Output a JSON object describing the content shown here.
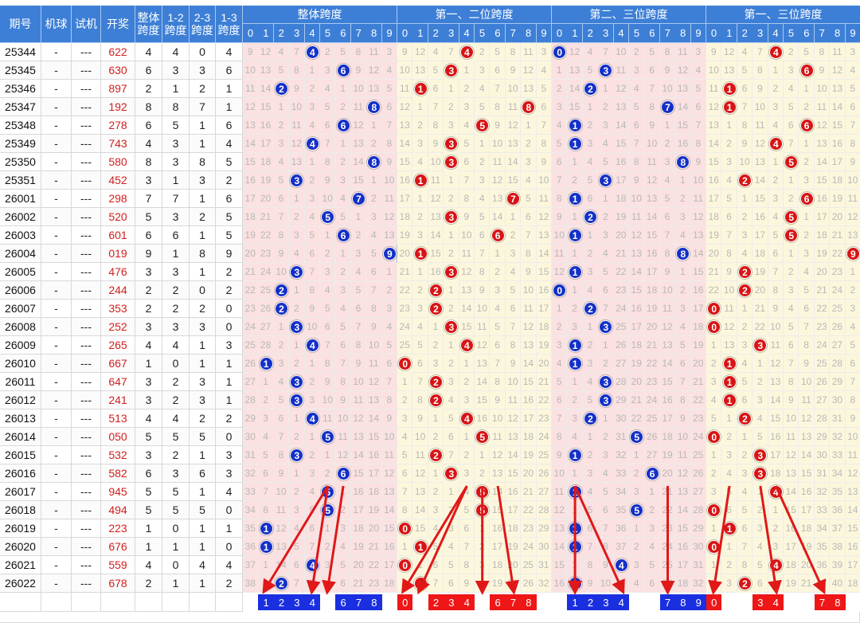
{
  "headers": {
    "issue": "期号",
    "machine_ball": "机球",
    "test_draw": "试机",
    "draw": "开奖",
    "span_total": "整体\n跨度",
    "span_12": "1-2\n跨度",
    "span_23": "2-3\n跨度",
    "span_13": "1-3\n跨度",
    "group_labels": [
      "整体跨度",
      "第一、二位跨度",
      "第二、三位跨度",
      "第一、三位跨度"
    ],
    "digits": [
      "0",
      "1",
      "2",
      "3",
      "4",
      "5",
      "6",
      "7",
      "8",
      "9"
    ]
  },
  "placeholders": {
    "machine_ball": "-",
    "test_draw": "---"
  },
  "rows": [
    {
      "issue": "25344",
      "draw": "622",
      "span_total": 4,
      "span_12": 4,
      "span_23": 0,
      "span_13": 4
    },
    {
      "issue": "25345",
      "draw": "630",
      "span_total": 6,
      "span_12": 3,
      "span_23": 3,
      "span_13": 6
    },
    {
      "issue": "25346",
      "draw": "897",
      "span_total": 2,
      "span_12": 1,
      "span_23": 2,
      "span_13": 1
    },
    {
      "issue": "25347",
      "draw": "192",
      "span_total": 8,
      "span_12": 8,
      "span_23": 7,
      "span_13": 1
    },
    {
      "issue": "25348",
      "draw": "278",
      "span_total": 6,
      "span_12": 5,
      "span_23": 1,
      "span_13": 6
    },
    {
      "issue": "25349",
      "draw": "743",
      "span_total": 4,
      "span_12": 3,
      "span_23": 1,
      "span_13": 4
    },
    {
      "issue": "25350",
      "draw": "580",
      "span_total": 8,
      "span_12": 3,
      "span_23": 8,
      "span_13": 5
    },
    {
      "issue": "25351",
      "draw": "452",
      "span_total": 3,
      "span_12": 1,
      "span_23": 3,
      "span_13": 2
    },
    {
      "issue": "26001",
      "draw": "298",
      "span_total": 7,
      "span_12": 7,
      "span_23": 1,
      "span_13": 6
    },
    {
      "issue": "26002",
      "draw": "520",
      "span_total": 5,
      "span_12": 3,
      "span_23": 2,
      "span_13": 5
    },
    {
      "issue": "26003",
      "draw": "601",
      "span_total": 6,
      "span_12": 6,
      "span_23": 1,
      "span_13": 5
    },
    {
      "issue": "26004",
      "draw": "019",
      "span_total": 9,
      "span_12": 1,
      "span_23": 8,
      "span_13": 9
    },
    {
      "issue": "26005",
      "draw": "476",
      "span_total": 3,
      "span_12": 3,
      "span_23": 1,
      "span_13": 2
    },
    {
      "issue": "26006",
      "draw": "244",
      "span_total": 2,
      "span_12": 2,
      "span_23": 0,
      "span_13": 2
    },
    {
      "issue": "26007",
      "draw": "353",
      "span_total": 2,
      "span_12": 2,
      "span_23": 2,
      "span_13": 0
    },
    {
      "issue": "26008",
      "draw": "252",
      "span_total": 3,
      "span_12": 3,
      "span_23": 3,
      "span_13": 0
    },
    {
      "issue": "26009",
      "draw": "265",
      "span_total": 4,
      "span_12": 4,
      "span_23": 1,
      "span_13": 3
    },
    {
      "issue": "26010",
      "draw": "667",
      "span_total": 1,
      "span_12": 0,
      "span_23": 1,
      "span_13": 1
    },
    {
      "issue": "26011",
      "draw": "647",
      "span_total": 3,
      "span_12": 2,
      "span_23": 3,
      "span_13": 1
    },
    {
      "issue": "26012",
      "draw": "241",
      "span_total": 3,
      "span_12": 2,
      "span_23": 3,
      "span_13": 1
    },
    {
      "issue": "26013",
      "draw": "513",
      "span_total": 4,
      "span_12": 4,
      "span_23": 2,
      "span_13": 2
    },
    {
      "issue": "26014",
      "draw": "050",
      "span_total": 5,
      "span_12": 5,
      "span_23": 5,
      "span_13": 0
    },
    {
      "issue": "26015",
      "draw": "532",
      "span_total": 3,
      "span_12": 2,
      "span_23": 1,
      "span_13": 3
    },
    {
      "issue": "26016",
      "draw": "582",
      "span_total": 6,
      "span_12": 3,
      "span_23": 6,
      "span_13": 3
    },
    {
      "issue": "26017",
      "draw": "945",
      "span_total": 5,
      "span_12": 5,
      "span_23": 1,
      "span_13": 4
    },
    {
      "issue": "26018",
      "draw": "494",
      "span_total": 5,
      "span_12": 5,
      "span_23": 5,
      "span_13": 0
    },
    {
      "issue": "26019",
      "draw": "223",
      "span_total": 1,
      "span_12": 0,
      "span_23": 1,
      "span_13": 1
    },
    {
      "issue": "26020",
      "draw": "676",
      "span_total": 1,
      "span_12": 1,
      "span_23": 1,
      "span_13": 0
    },
    {
      "issue": "26021",
      "draw": "559",
      "span_total": 4,
      "span_12": 0,
      "span_23": 4,
      "span_13": 4
    },
    {
      "issue": "26022",
      "draw": "678",
      "span_total": 2,
      "span_12": 1,
      "span_23": 1,
      "span_13": 2
    }
  ],
  "forecast_picks": [
    [
      "1",
      "2",
      "3",
      "4",
      "6",
      "7",
      "8"
    ],
    [
      "0",
      "2",
      "3",
      "4",
      "6",
      "7",
      "8"
    ],
    [
      "1",
      "2",
      "3",
      "4",
      "7",
      "8",
      "9"
    ],
    [
      "0",
      "3",
      "4",
      "7",
      "8"
    ]
  ],
  "colors": {
    "header_blue": "#3d7fd6",
    "zone_pink": "#fbe1e1",
    "zone_yellow": "#fcf7dc",
    "ball_blue": "#1530c8",
    "ball_red": "#d81414",
    "pick_blue": "#1a2fe0",
    "pick_red": "#ee1616",
    "arrow_red": "#e01818"
  }
}
